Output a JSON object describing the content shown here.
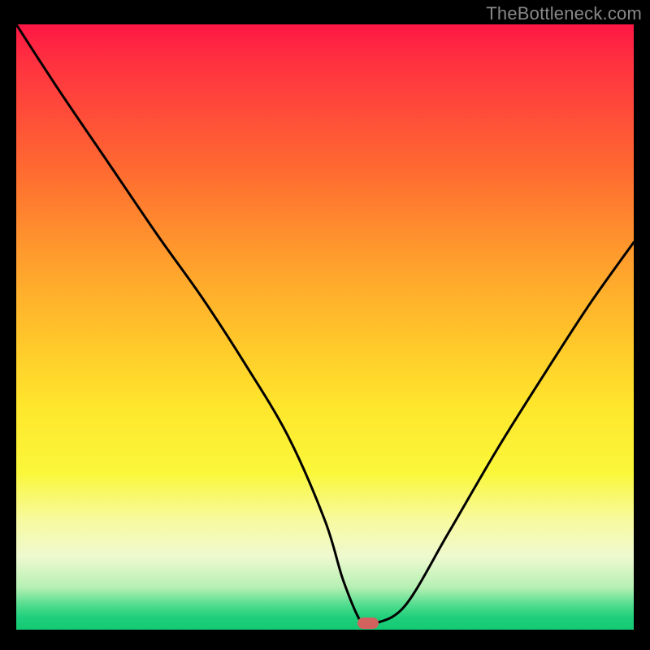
{
  "attribution": "TheBottleneck.com",
  "marker": {
    "label": "bottleneck-marker",
    "size": 26
  },
  "chart_data": {
    "type": "line",
    "title": "",
    "xlabel": "",
    "ylabel": "",
    "xlim": [
      0,
      1
    ],
    "ylim": [
      0,
      1
    ],
    "x": [
      0.0,
      0.07,
      0.15,
      0.23,
      0.3,
      0.37,
      0.44,
      0.5,
      0.53,
      0.56,
      0.58,
      0.63,
      0.7,
      0.78,
      0.86,
      0.93,
      1.0
    ],
    "values": [
      1.0,
      0.89,
      0.77,
      0.65,
      0.55,
      0.44,
      0.32,
      0.18,
      0.08,
      0.01,
      0.01,
      0.04,
      0.16,
      0.3,
      0.43,
      0.54,
      0.64
    ],
    "minimum_x": 0.57
  }
}
